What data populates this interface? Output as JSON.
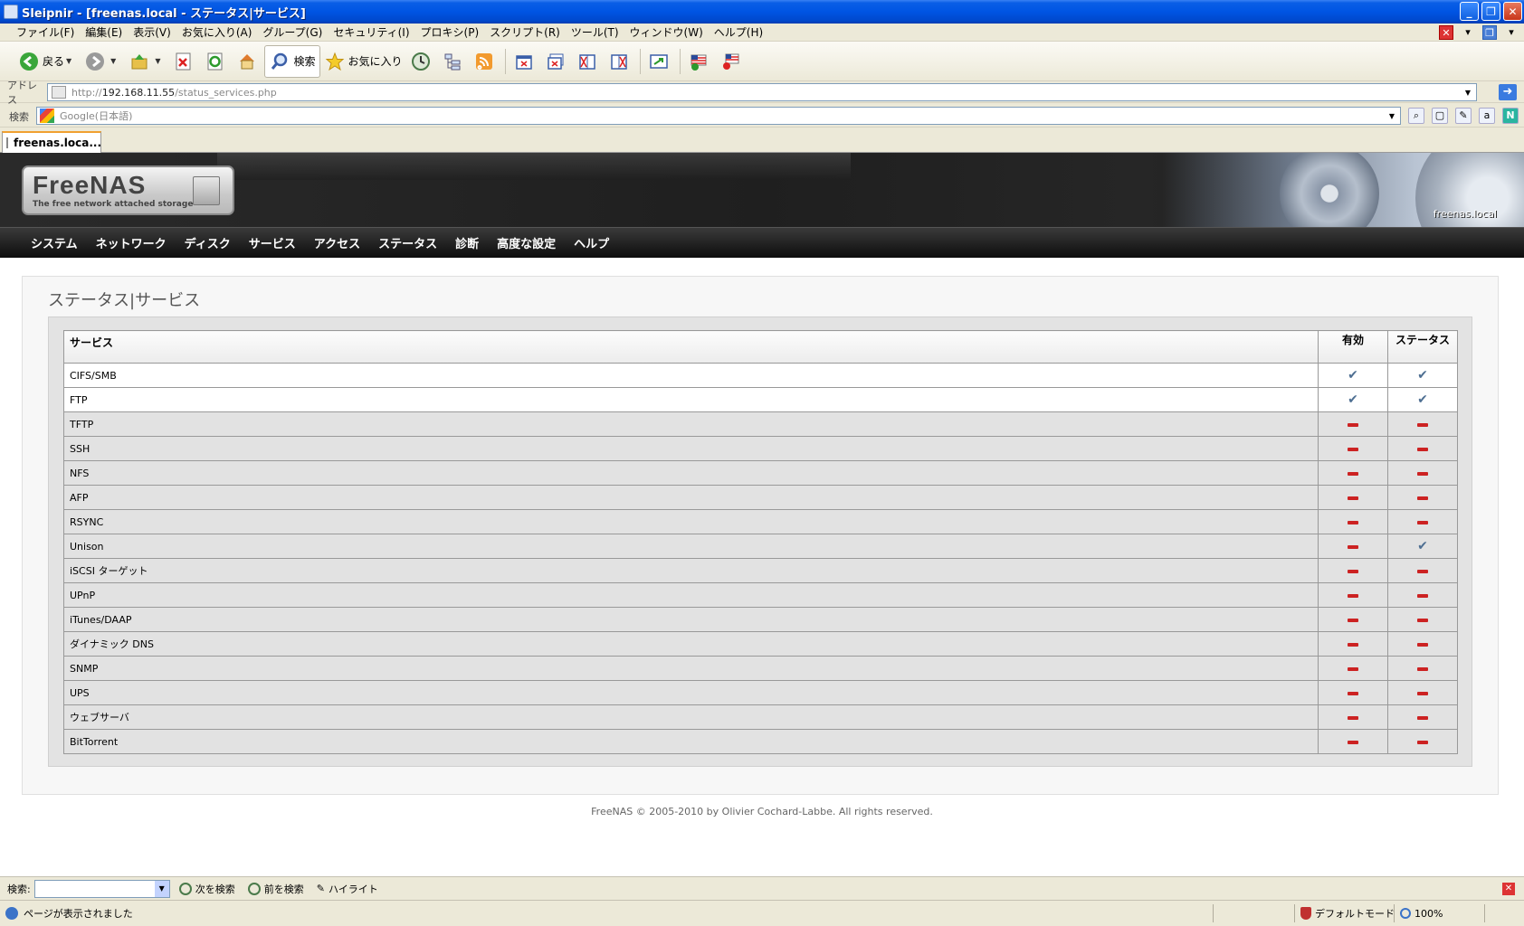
{
  "window": {
    "title": "Sleipnir - [freenas.local - ステータス|サービス]"
  },
  "menubar": {
    "items": [
      "ファイル(F)",
      "編集(E)",
      "表示(V)",
      "お気に入り(A)",
      "グループ(G)",
      "セキュリティ(I)",
      "プロキシ(P)",
      "スクリプト(R)",
      "ツール(T)",
      "ウィンドウ(W)",
      "ヘルプ(H)"
    ]
  },
  "toolbar": {
    "back_label": "戻る",
    "search_label": "検索",
    "favorites_label": "お気に入り"
  },
  "address": {
    "label": "アドレス",
    "url_prefix": "http://",
    "url_host": "192.168.11.55",
    "url_path": "/status_services.php"
  },
  "searchbar": {
    "label": "検索",
    "placeholder": "Google(日本語)"
  },
  "tab": {
    "label": "freenas.loca..."
  },
  "page": {
    "logo_name": "FreeNAS",
    "logo_tagline": "The free network attached storage",
    "hostname": "freenas.local",
    "nav": [
      "システム",
      "ネットワーク",
      "ディスク",
      "サービス",
      "アクセス",
      "ステータス",
      "診断",
      "高度な設定",
      "ヘルプ"
    ],
    "title": "ステータス|サービス",
    "table": {
      "headers": {
        "service": "サービス",
        "enabled": "有効",
        "status": "ステータス"
      },
      "rows": [
        {
          "name": "CIFS/SMB",
          "enabled": true,
          "status": true
        },
        {
          "name": "FTP",
          "enabled": true,
          "status": true
        },
        {
          "name": "TFTP",
          "enabled": false,
          "status": false
        },
        {
          "name": "SSH",
          "enabled": false,
          "status": false
        },
        {
          "name": "NFS",
          "enabled": false,
          "status": false
        },
        {
          "name": "AFP",
          "enabled": false,
          "status": false
        },
        {
          "name": "RSYNC",
          "enabled": false,
          "status": false
        },
        {
          "name": "Unison",
          "enabled": false,
          "status": true
        },
        {
          "name": "iSCSI ターゲット",
          "enabled": false,
          "status": false
        },
        {
          "name": "UPnP",
          "enabled": false,
          "status": false
        },
        {
          "name": "iTunes/DAAP",
          "enabled": false,
          "status": false
        },
        {
          "name": "ダイナミック DNS",
          "enabled": false,
          "status": false
        },
        {
          "name": "SNMP",
          "enabled": false,
          "status": false
        },
        {
          "name": "UPS",
          "enabled": false,
          "status": false
        },
        {
          "name": "ウェブサーバ",
          "enabled": false,
          "status": false
        },
        {
          "name": "BitTorrent",
          "enabled": false,
          "status": false
        }
      ]
    },
    "footer": "FreeNAS © 2005-2010 by Olivier Cochard-Labbe. All rights reserved."
  },
  "findbar": {
    "label": "検索:",
    "next_label": "次を検索",
    "prev_label": "前を検索",
    "highlight_label": "ハイライト"
  },
  "statusbar": {
    "text": "ページが表示されました",
    "mode": "デフォルトモード",
    "zoom": "100%"
  },
  "colors": {
    "title_bar": "#0054e3",
    "nav_bar": "#1a1a1a",
    "check": "#4e6f92",
    "dash": "#cc2222"
  }
}
